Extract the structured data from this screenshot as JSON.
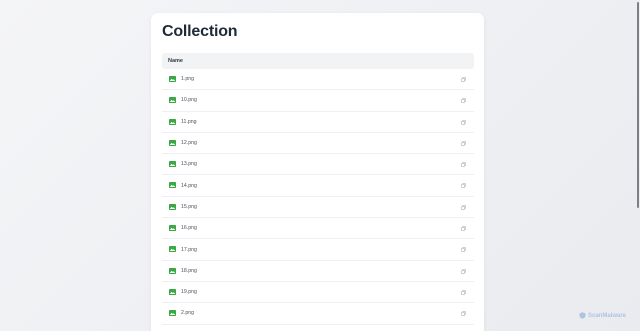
{
  "page": {
    "title": "Collection"
  },
  "table": {
    "header": "Name",
    "rows": [
      {
        "name": "1.png"
      },
      {
        "name": "10.png"
      },
      {
        "name": "11.png"
      },
      {
        "name": "12.png"
      },
      {
        "name": "13.png"
      },
      {
        "name": "14.png"
      },
      {
        "name": "15.png"
      },
      {
        "name": "16.png"
      },
      {
        "name": "17.png"
      },
      {
        "name": "18.png"
      },
      {
        "name": "19.png"
      },
      {
        "name": "2.png"
      }
    ]
  },
  "watermark": {
    "text": "ScanMalware"
  },
  "colors": {
    "accent_green": "#3aa845",
    "title": "#1f2a37",
    "watermark": "#7fa3d4"
  },
  "icons": {
    "file": "image-file-icon",
    "action": "copy-icon"
  }
}
